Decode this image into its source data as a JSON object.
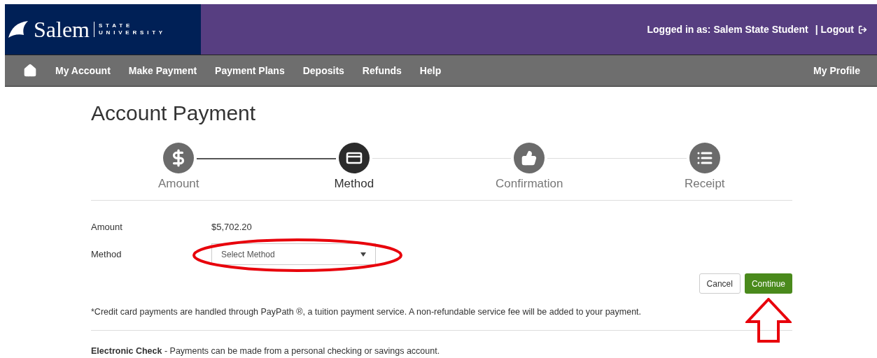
{
  "logo": {
    "wordmark": "Salem",
    "tag_top": "STATE",
    "tag_bottom": "UNIVERSITY"
  },
  "header": {
    "user_text": "Logged in as: Salem State Student",
    "logout": "| Logout"
  },
  "nav": {
    "items": [
      "My Account",
      "Make Payment",
      "Payment Plans",
      "Deposits",
      "Refunds",
      "Help"
    ],
    "profile": "My Profile"
  },
  "page_title": "Account Payment",
  "steps": [
    {
      "label": "Amount",
      "kind": "dollar",
      "selected": false
    },
    {
      "label": "Method",
      "kind": "card",
      "selected": true
    },
    {
      "label": "Confirmation",
      "kind": "thumb",
      "selected": false
    },
    {
      "label": "Receipt",
      "kind": "list",
      "selected": false
    }
  ],
  "step_connectors": [
    {
      "completed": true
    },
    {
      "completed": false
    },
    {
      "completed": false
    }
  ],
  "form": {
    "amount_label": "Amount",
    "amount_value": "$5,702.20",
    "method_label": "Method",
    "method_placeholder": "Select Method"
  },
  "buttons": {
    "cancel": "Cancel",
    "continue": "Continue"
  },
  "note": "*Credit card payments are handled through PayPath ®, a tuition payment service. A non-refundable service fee will be added to your payment.",
  "echeck": "**Electronic Check** - Payments can be made from a personal checking or savings  account."
}
